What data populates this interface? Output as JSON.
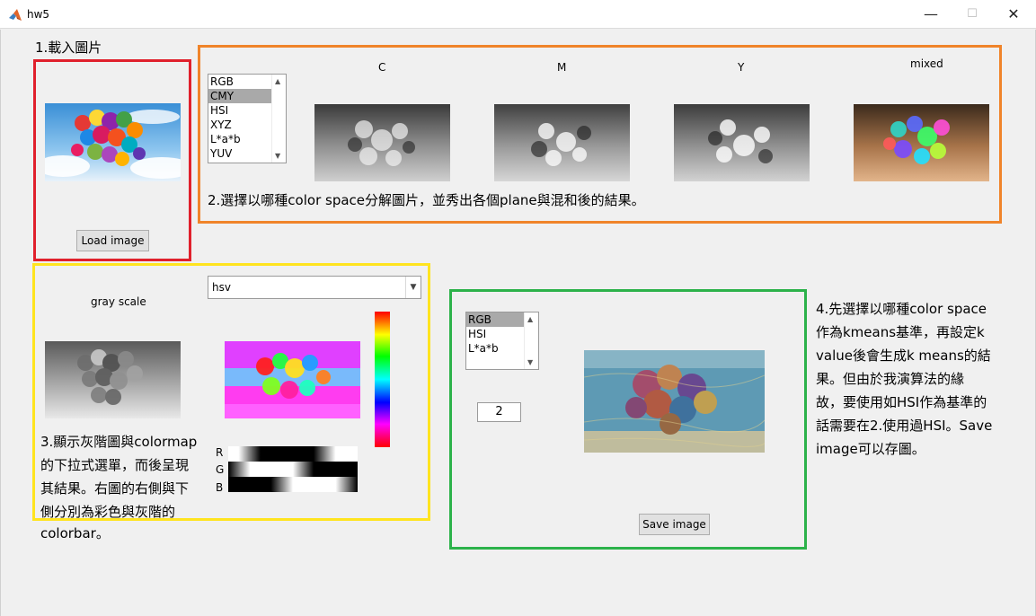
{
  "window": {
    "title": "hw5",
    "minimize": "—",
    "maximize": "☐",
    "close": "✕"
  },
  "section1": {
    "label": "1.載入圖片",
    "load_button": "Load image"
  },
  "section2": {
    "listbox_items": [
      "RGB",
      "CMY",
      "HSI",
      "XYZ",
      "L*a*b",
      "YUV"
    ],
    "selected_index": 1,
    "plane_labels": [
      "C",
      "M",
      "Y",
      "mixed"
    ],
    "description": "2.選擇以哪種color space分解圖片，並秀出各個plane與混和後的結果。"
  },
  "section3": {
    "gray_label": "gray scale",
    "colormap_selected": "hsv",
    "rgb_labels": [
      "R",
      "G",
      "B"
    ],
    "description_lines": [
      "3.顯示灰階圖與colormap",
      "的下拉式選單，而後呈現",
      "其結果。右圖的右側與下",
      "側分別為彩色與灰階的",
      "colorbar。"
    ]
  },
  "section4": {
    "listbox_items": [
      "RGB",
      "HSI",
      "L*a*b"
    ],
    "selected_index": 0,
    "k_value": "2",
    "save_button": "Save image",
    "description_lines": [
      "4.先選擇以哪種color space",
      "作為kmeans基準，再設定k",
      "value後會生成k means的結",
      "果。但由於我演算法的緣",
      "故，要使用如HSI作為基準的",
      "話需要在2.使用過HSI。Save",
      "image可以存圖。"
    ]
  }
}
